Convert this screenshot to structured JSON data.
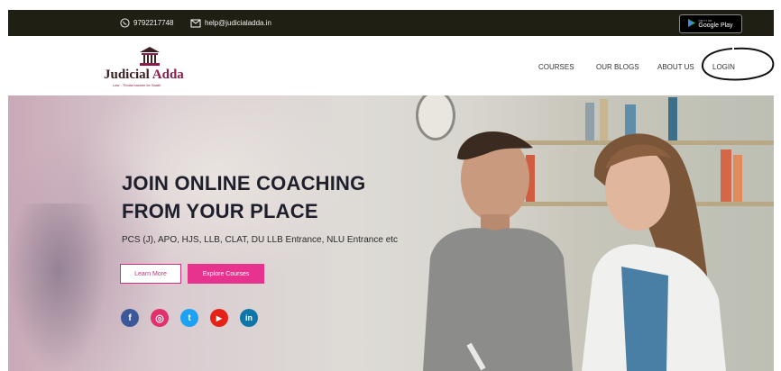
{
  "topbar": {
    "phone": "9792217748",
    "email": "help@judicialadda.in",
    "store_badge_small": "GET IT ON",
    "store_badge": "Google Play"
  },
  "logo": {
    "name_part1": "Judicial ",
    "name_part2": "Adda",
    "tagline": "Law - Thoda hasnee ke Saath"
  },
  "nav": {
    "items": [
      {
        "label": "COURSES"
      },
      {
        "label": "OUR BLOGS"
      },
      {
        "label": "ABOUT US"
      },
      {
        "label": "LOGIN"
      }
    ]
  },
  "hero": {
    "headline_line1": "JOIN ONLINE COACHING",
    "headline_line2": "FROM YOUR PLACE",
    "subtitle": "PCS (J), APO, HJS, LLB, CLAT, DU LLB Entrance, NLU Entrance etc",
    "learn_more": "Learn More",
    "explore": "Explore Courses"
  },
  "social": [
    {
      "icon": "facebook-icon",
      "color": "#3b5998",
      "glyph": "f"
    },
    {
      "icon": "instagram-icon",
      "color": "#e1306c",
      "glyph": "◎"
    },
    {
      "icon": "twitter-icon",
      "color": "#1da1f2",
      "glyph": "t"
    },
    {
      "icon": "youtube-icon",
      "color": "#e62117",
      "glyph": "▶"
    },
    {
      "icon": "linkedin-icon",
      "color": "#0e76a8",
      "glyph": "in"
    }
  ],
  "colors": {
    "topbar_bg": "#201f14",
    "accent_pink": "#e8338e",
    "brand_maroon": "#8a1d4a"
  }
}
